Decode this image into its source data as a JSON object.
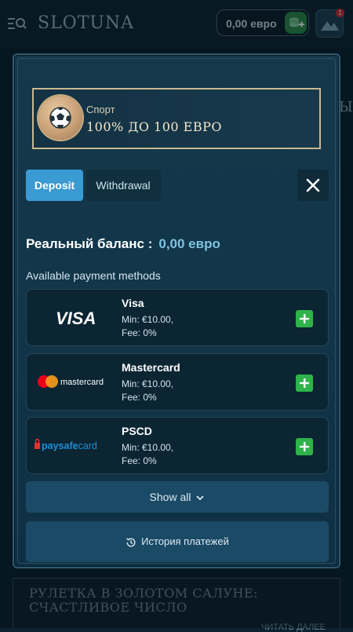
{
  "app": {
    "logo": "SLOTUNA",
    "balance": "0,00 евро",
    "avatar_badge": "1",
    "side_text": "Ы"
  },
  "background_article": {
    "title": "Рулетка в золотом салуне: счастливое число",
    "read_more": "ЧИТАТЬ ДАЛЕЕ"
  },
  "promo": {
    "subtitle": "Спорт",
    "title": "100% ДО 100 ЕВРО",
    "icon": "soccer-ball-icon"
  },
  "tabs": [
    {
      "label": "Deposit",
      "active": true
    },
    {
      "label": "Withdrawal",
      "active": false
    }
  ],
  "balance": {
    "label": "Реальный баланс :",
    "value": "0,00 евро"
  },
  "methods": {
    "title": "Available payment methods",
    "items": [
      {
        "logo": "visa-logo",
        "logo_text": "VISA",
        "name": "Visa",
        "min": "Min: €10.00,",
        "fee": "Fee: 0%"
      },
      {
        "logo": "mastercard-logo",
        "logo_text": "mastercard",
        "name": "Mastercard",
        "min": "Min: €10.00,",
        "fee": "Fee: 0%"
      },
      {
        "logo": "paysafecard-logo",
        "logo_text_1": "paysafe",
        "logo_text_2": "card",
        "name": "PSCD",
        "min": "Min: €10.00,",
        "fee": "Fee: 0%"
      }
    ]
  },
  "buttons": {
    "show_all": "Show all",
    "history": "История платежей"
  },
  "colors": {
    "accent": "#3a9ad2",
    "add_green": "#2db34a",
    "balance_value": "#7fc3e0",
    "promo_border": "#c9b98f"
  }
}
